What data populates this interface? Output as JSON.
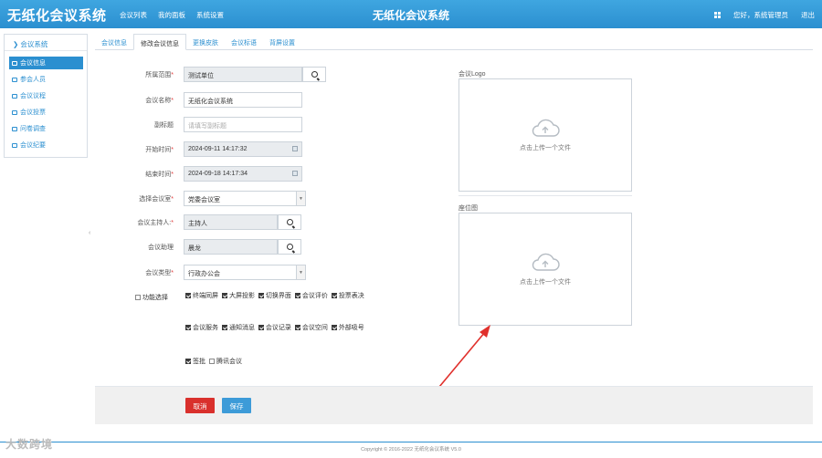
{
  "header": {
    "logo": "无纸化会议系统",
    "nav": [
      "会议列表",
      "我的面板",
      "系统设置"
    ],
    "title": "无纸化会议系统",
    "greeting": "您好，系统管理员",
    "logout": "退出"
  },
  "sidebar": {
    "title": "会议系统",
    "items": [
      {
        "label": "会议信息",
        "icon": "list-icon"
      },
      {
        "label": "参会人员",
        "icon": "user-icon"
      },
      {
        "label": "会议议程",
        "icon": "agenda-icon"
      },
      {
        "label": "会议投票",
        "icon": "vote-icon"
      },
      {
        "label": "问卷调查",
        "icon": "chat-icon"
      },
      {
        "label": "会议纪要",
        "icon": "file-icon"
      }
    ]
  },
  "tabs": [
    "会议信息",
    "修改会议信息",
    "更换皮肤",
    "会议标语",
    "背屏设置"
  ],
  "form": {
    "scope": {
      "label": "所属范围",
      "value": "测试单位"
    },
    "name": {
      "label": "会议名称",
      "value": "无纸化会议系统"
    },
    "subtitle": {
      "label": "副标题",
      "placeholder": "请填写副标题"
    },
    "start": {
      "label": "开始时间",
      "value": "2024-09-11 14:17:32"
    },
    "end": {
      "label": "结束时间",
      "value": "2024-09-18 14:17:34"
    },
    "room": {
      "label": "选择会议室",
      "value": "党委会议室"
    },
    "host": {
      "label": "会议主持人:",
      "value": "主持人"
    },
    "assistant": {
      "label": "会议助理",
      "value": "晨龙"
    },
    "type": {
      "label": "会议类型",
      "value": "行政办公会"
    },
    "features": {
      "label": "功能选择",
      "items": [
        {
          "label": "终端同屏",
          "checked": true
        },
        {
          "label": "大屏投影",
          "checked": true
        },
        {
          "label": "切换界面",
          "checked": true
        },
        {
          "label": "会议评价",
          "checked": true
        },
        {
          "label": "投票表决",
          "checked": true
        },
        {
          "label": "会议服务",
          "checked": true
        },
        {
          "label": "通知消息",
          "checked": true
        },
        {
          "label": "会议记录",
          "checked": true
        },
        {
          "label": "会议空间",
          "checked": true
        },
        {
          "label": "外部吸号",
          "checked": true
        },
        {
          "label": "签批",
          "checked": true
        },
        {
          "label": "腾讯会议",
          "checked": false
        }
      ]
    },
    "required_mark": "*"
  },
  "uploads": {
    "logo_label": "会议Logo",
    "seat_label": "座位图",
    "hint": "点击上传一个文件"
  },
  "actions": {
    "cancel": "取消",
    "save": "保存"
  },
  "footer": {
    "copyright": "Copyright © 2016-2022 无纸化会议系统 V5.0"
  },
  "watermark": "大数跨境",
  "colors": {
    "brand": "#2b8fd0",
    "danger": "#d9302c",
    "arrow": "#e0302c"
  }
}
